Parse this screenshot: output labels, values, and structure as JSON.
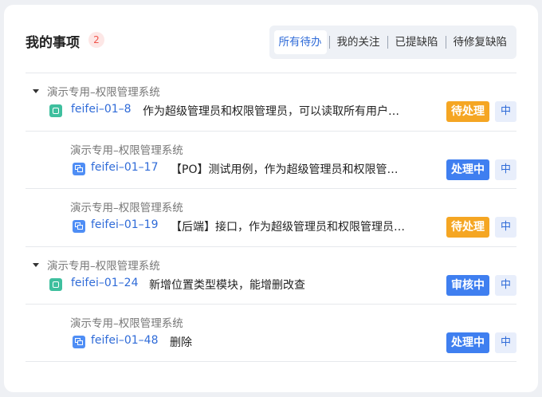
{
  "header": {
    "title": "我的事项",
    "count": "2",
    "tabs": [
      "所有待办",
      "我的关注",
      "已提缺陷",
      "待修复缺陷"
    ]
  },
  "items": [
    {
      "group": "演示专用–权限管理系统",
      "code": "feifei–01–8",
      "text": "作为超级管理员和权限管理员，可以读取所有用户…",
      "status": "待处理",
      "priority": "中",
      "icon": "story-icon",
      "expanded": true
    },
    {
      "group": "演示专用–权限管理系统",
      "code": "feifei–01–17",
      "text": "【PO】测试用例，作为超级管理员和权限管理…",
      "status": "处理中",
      "priority": "中",
      "icon": "task-icon"
    },
    {
      "group": "演示专用–权限管理系统",
      "code": "feifei–01–19",
      "text": "【后端】接口，作为超级管理员和权限管理员，…",
      "status": "待处理",
      "priority": "中",
      "icon": "task-icon"
    },
    {
      "group": "演示专用–权限管理系统",
      "code": "feifei–01–24",
      "text": "新增位置类型模块，能增删改查",
      "status": "审核中",
      "priority": "中",
      "icon": "story-icon",
      "expanded": true
    },
    {
      "group": "演示专用–权限管理系统",
      "code": "feifei–01–48",
      "text": "删除",
      "status": "处理中",
      "priority": "中",
      "icon": "task-icon"
    }
  ],
  "colors": {
    "accent": "#2f6bd8",
    "pending": "#f5a623",
    "in_progress": "#3f7ff0",
    "story_icon": "#3ebf9e",
    "task_icon": "#4f8ef5"
  }
}
